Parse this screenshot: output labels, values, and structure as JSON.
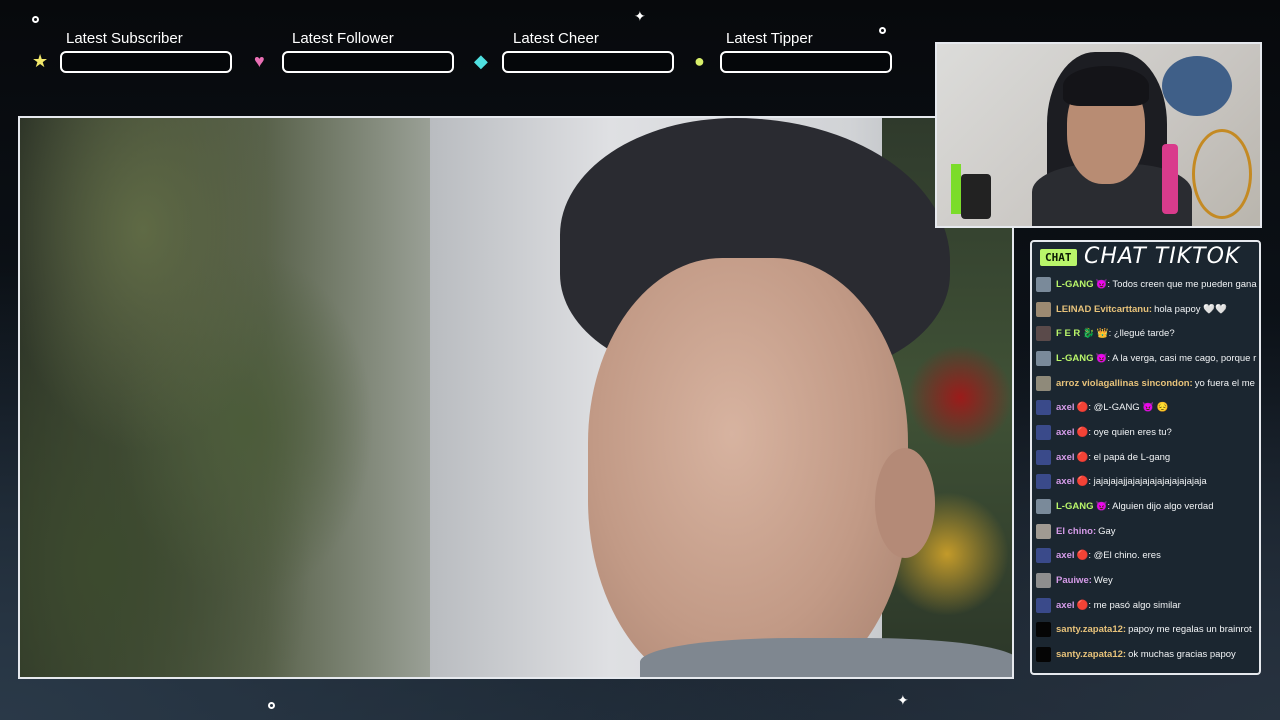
{
  "alerts": [
    {
      "label": "Latest Subscriber",
      "icon": "star-icon",
      "glyph": "★",
      "color": "#f2e86b",
      "value": ""
    },
    {
      "label": "Latest Follower",
      "icon": "heart-icon",
      "glyph": "♥",
      "color": "#e96fb4",
      "value": ""
    },
    {
      "label": "Latest Cheer",
      "icon": "diamond-icon",
      "glyph": "◆",
      "color": "#4fe0e0",
      "value": ""
    },
    {
      "label": "Latest Tipper",
      "icon": "coin-icon",
      "glyph": "●",
      "color": "#d8ef6a",
      "value": ""
    }
  ],
  "chat": {
    "badge": "CHAT",
    "title": "CHAT TIKTOK",
    "messages": [
      {
        "user": "L-GANG",
        "badge": "😈",
        "user_color": "#b9f56a",
        "avatar_color": "#7a8a9a",
        "text": ": Todos creen que me pueden gana"
      },
      {
        "user": "LEINAD Evitcarttanu:",
        "badge": "",
        "user_color": "#e7c27a",
        "avatar_color": "#9c8a72",
        "text": "hola papoy 🤍🤍"
      },
      {
        "user": "F E R 🐉",
        "badge": "👑",
        "user_color": "#b9f56a",
        "avatar_color": "#5a4a4a",
        "text": ": ¿llegué tarde?"
      },
      {
        "user": "L-GANG",
        "badge": "😈",
        "user_color": "#b9f56a",
        "avatar_color": "#7a8a9a",
        "text": ": A la verga, casi me cago, porque r"
      },
      {
        "user": "arroz violagallinas sincondon:",
        "badge": "",
        "user_color": "#e7c27a",
        "avatar_color": "#8f8a7a",
        "text": "yo fuera el me l"
      },
      {
        "user": "axel",
        "badge": "🔴",
        "user_color": "#d59be8",
        "avatar_color": "#3a4a8a",
        "text": ": @L-GANG 😈 😔"
      },
      {
        "user": "axel",
        "badge": "🔴",
        "user_color": "#d59be8",
        "avatar_color": "#3a4a8a",
        "text": ": oye quien eres tu?"
      },
      {
        "user": "axel",
        "badge": "🔴",
        "user_color": "#d59be8",
        "avatar_color": "#3a4a8a",
        "text": ": el papá de L-gang"
      },
      {
        "user": "axel",
        "badge": "🔴",
        "user_color": "#d59be8",
        "avatar_color": "#3a4a8a",
        "text": ": jajajajajjajajajajajajajajajaja"
      },
      {
        "user": "L-GANG",
        "badge": "😈",
        "user_color": "#b9f56a",
        "avatar_color": "#7a8a9a",
        "text": ": Alguien dijo algo verdad"
      },
      {
        "user": "El chino:",
        "badge": "",
        "user_color": "#d59be8",
        "avatar_color": "#a09a92",
        "text": "Gay"
      },
      {
        "user": "axel",
        "badge": "🔴",
        "user_color": "#d59be8",
        "avatar_color": "#3a4a8a",
        "text": ": @El chino. eres"
      },
      {
        "user": "Pauiwe:",
        "badge": "",
        "user_color": "#d59be8",
        "avatar_color": "#8e8e8e",
        "text": "Wey"
      },
      {
        "user": "axel",
        "badge": "🔴",
        "user_color": "#d59be8",
        "avatar_color": "#3a4a8a",
        "text": ": me pasó algo similar"
      },
      {
        "user": "santy.zapata12:",
        "badge": "",
        "user_color": "#e7c27a",
        "avatar_color": "#050505",
        "text": "papoy me regalas un brainrot"
      },
      {
        "user": "santy.zapata12:",
        "badge": "",
        "user_color": "#e7c27a",
        "avatar_color": "#050505",
        "text": "ok muchas gracias papoy"
      }
    ]
  }
}
